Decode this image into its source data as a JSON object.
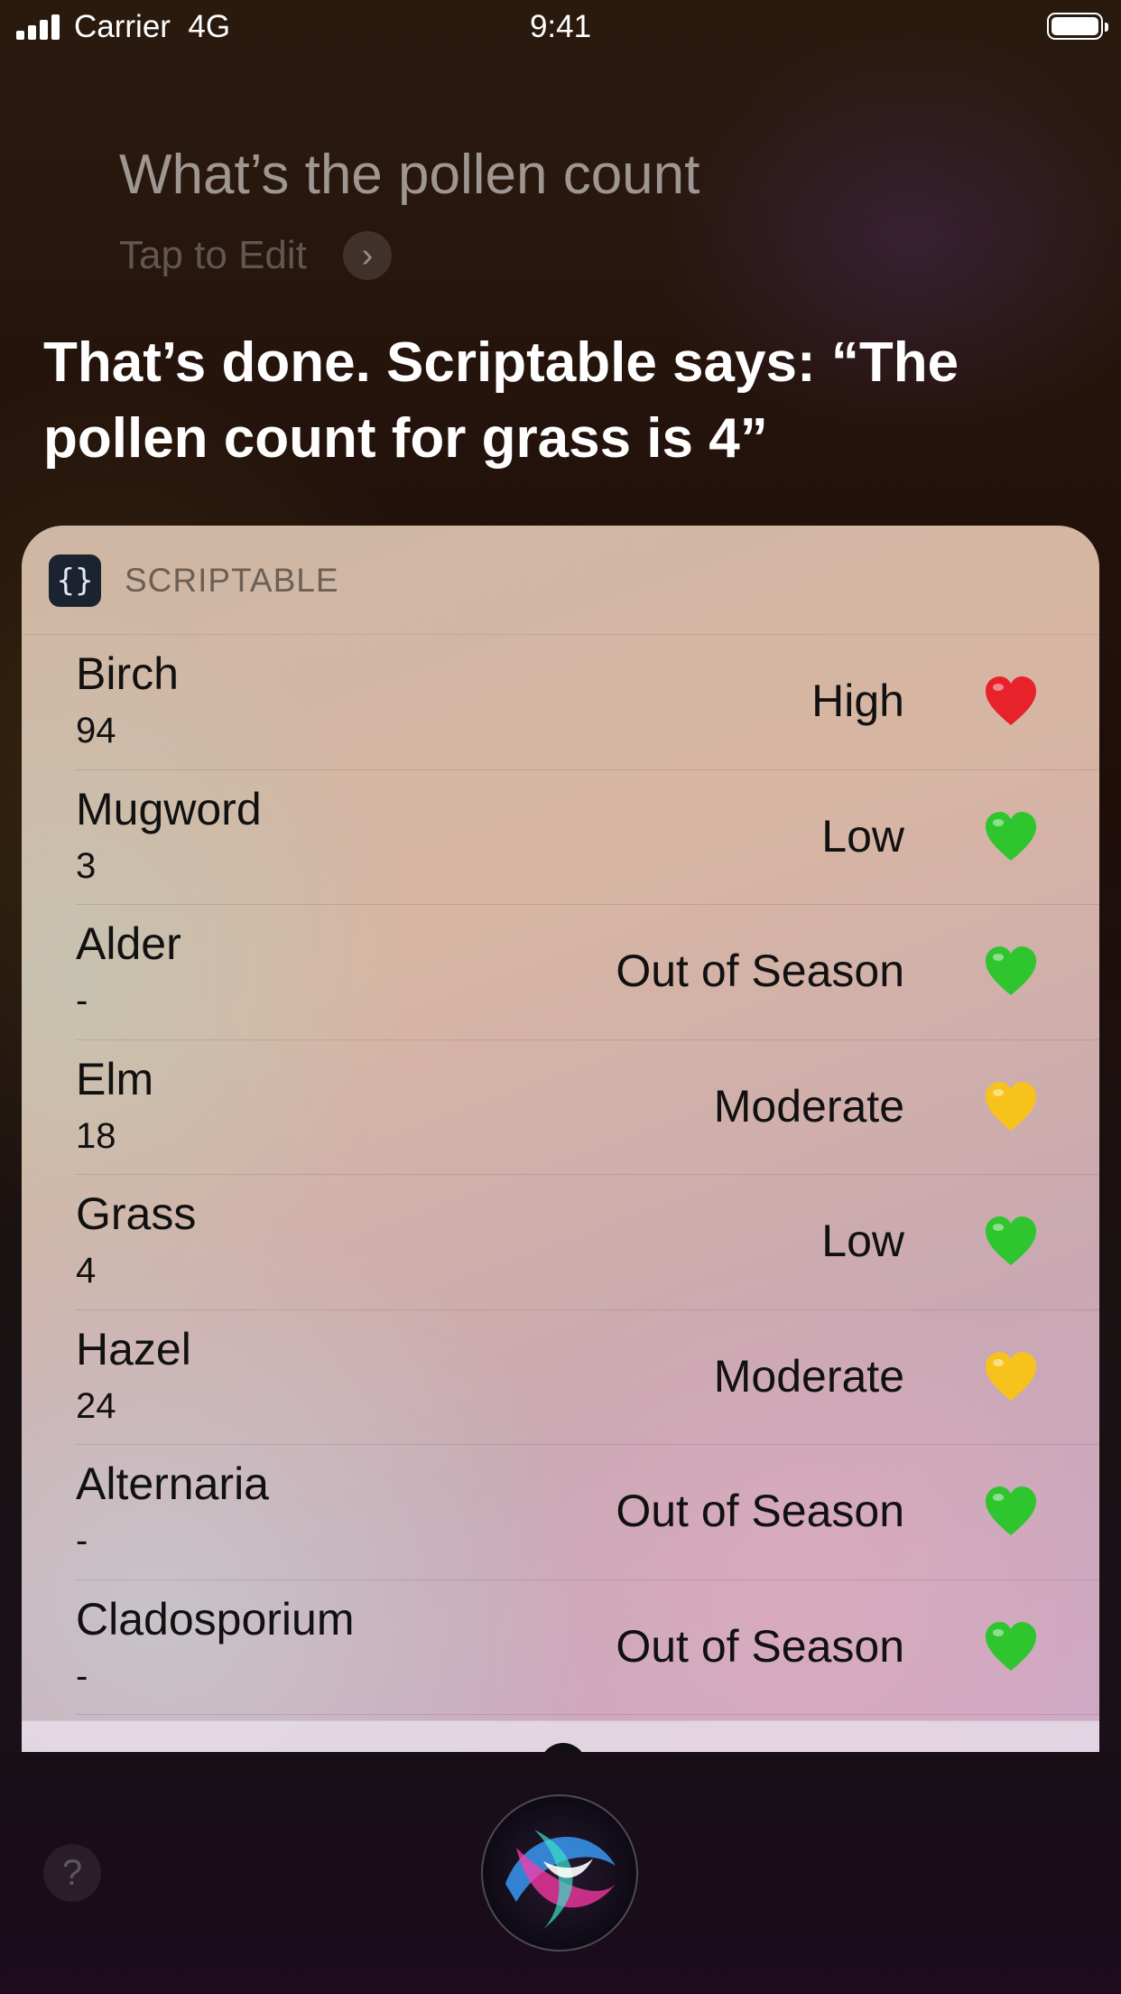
{
  "status_bar": {
    "carrier": "Carrier",
    "network": "4G",
    "time": "9:41"
  },
  "siri": {
    "query": "What’s the pollen count",
    "tap_to_edit": "Tap to Edit",
    "response": "That’s done. Scriptable says: “The pollen count for grass is 4”"
  },
  "card": {
    "app_name": "SCRIPTABLE",
    "app_icon_glyph": "{}",
    "rows": [
      {
        "name": "Birch",
        "value": "94",
        "level": "High",
        "heart": "red-heart-icon",
        "color": "#e8222a"
      },
      {
        "name": "Mugword",
        "value": "3",
        "level": "Low",
        "heart": "green-heart-icon",
        "color": "#2fc52f"
      },
      {
        "name": "Alder",
        "value": "-",
        "level": "Out of Season",
        "heart": "green-heart-icon",
        "color": "#2fc52f"
      },
      {
        "name": "Elm",
        "value": "18",
        "level": "Moderate",
        "heart": "yellow-heart-icon",
        "color": "#f7c21c"
      },
      {
        "name": "Grass",
        "value": "4",
        "level": "Low",
        "heart": "green-heart-icon",
        "color": "#2fc52f"
      },
      {
        "name": "Hazel",
        "value": "24",
        "level": "Moderate",
        "heart": "yellow-heart-icon",
        "color": "#f7c21c"
      },
      {
        "name": "Alternaria",
        "value": "-",
        "level": "Out of Season",
        "heart": "green-heart-icon",
        "color": "#2fc52f"
      },
      {
        "name": "Cladosporium",
        "value": "-",
        "level": "Out of Season",
        "heart": "green-heart-icon",
        "color": "#2fc52f"
      }
    ]
  },
  "bottom": {
    "help_glyph": "?"
  }
}
